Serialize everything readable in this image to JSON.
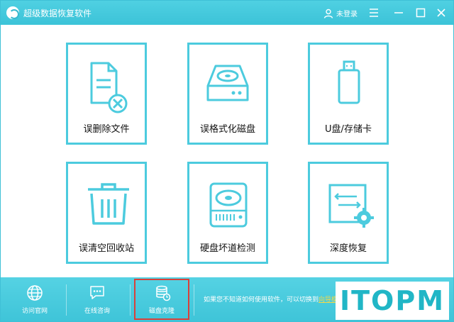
{
  "window": {
    "title": "超级数据恢复软件",
    "user_label": "未登录",
    "accent": "#4ccbde"
  },
  "tiles": [
    {
      "label": "误删除文件",
      "icon": "document-delete-icon"
    },
    {
      "label": "误格式化磁盘",
      "icon": "hard-disk-icon"
    },
    {
      "label": "U盘/存储卡",
      "icon": "usb-drive-icon"
    },
    {
      "label": "误清空回收站",
      "icon": "trash-bin-icon"
    },
    {
      "label": "硬盘坏道检测",
      "icon": "disk-drive-icon"
    },
    {
      "label": "深度恢复",
      "icon": "deep-recovery-icon"
    }
  ],
  "bottom_nav": [
    {
      "label": "访问官网",
      "icon": "globe-icon"
    },
    {
      "label": "在线咨询",
      "icon": "chat-icon"
    },
    {
      "label": "磁盘克隆",
      "icon": "database-clone-icon",
      "highlighted": true
    }
  ],
  "hint": {
    "text": "如果您不知道如何使用软件，可以切换到",
    "link": "向导模"
  },
  "watermark": "ITOPM"
}
